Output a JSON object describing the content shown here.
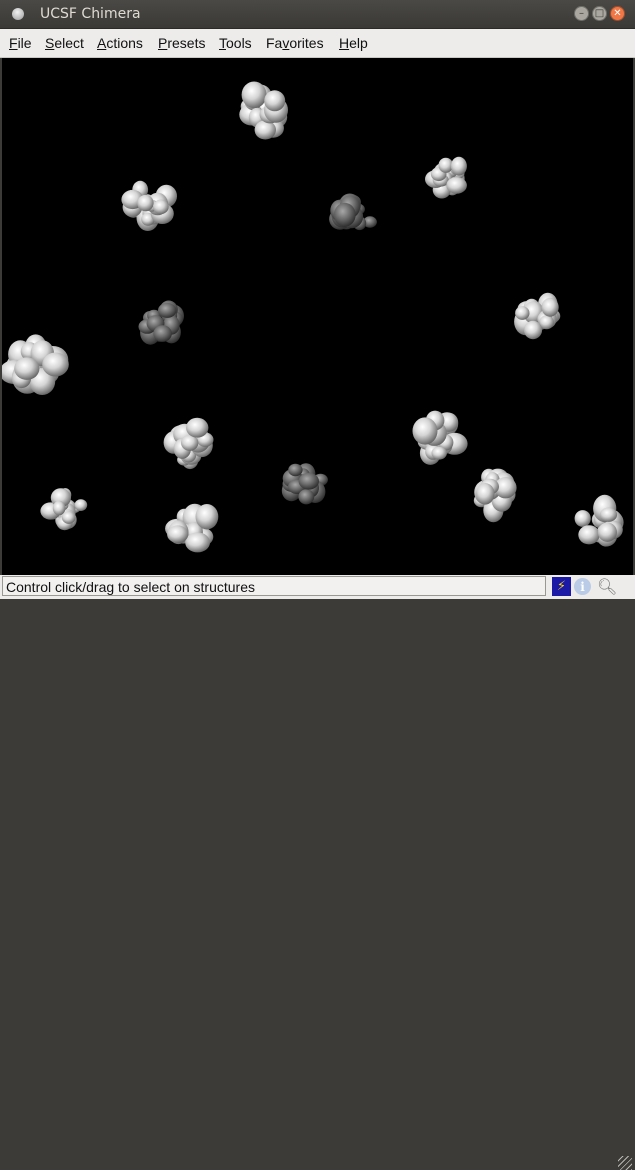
{
  "window": {
    "title": "UCSF Chimera"
  },
  "menubar": {
    "items": [
      {
        "pre": "",
        "ul": "F",
        "post": "ile"
      },
      {
        "pre": "",
        "ul": "S",
        "post": "elect"
      },
      {
        "pre": "",
        "ul": "A",
        "post": "ctions"
      },
      {
        "pre": "",
        "ul": "P",
        "post": "resets"
      },
      {
        "pre": "",
        "ul": "T",
        "post": "ools"
      },
      {
        "pre": "Fa",
        "ul": "v",
        "post": "orites"
      },
      {
        "pre": "",
        "ul": "H",
        "post": "elp"
      }
    ]
  },
  "viewer": {
    "background": "#000000",
    "structures": [
      {
        "tone": "bright"
      },
      {
        "tone": "bright"
      },
      {
        "tone": "dim"
      },
      {
        "tone": "bright"
      },
      {
        "tone": "dim"
      },
      {
        "tone": "bright"
      },
      {
        "tone": "bright"
      },
      {
        "tone": "bright"
      },
      {
        "tone": "bright"
      },
      {
        "tone": "dim"
      },
      {
        "tone": "bright"
      },
      {
        "tone": "bright"
      },
      {
        "tone": "bright"
      },
      {
        "tone": "bright"
      },
      {
        "tone": "bright"
      }
    ]
  },
  "statusbar": {
    "message": "Control click/drag to select on structures",
    "icons": [
      "lightning-icon",
      "info-icon",
      "magnifier-icon"
    ]
  },
  "colors": {
    "accent_close": "#f07746",
    "structure_bright": "#d8d8d8",
    "structure_dim": "#6e6e6e"
  }
}
